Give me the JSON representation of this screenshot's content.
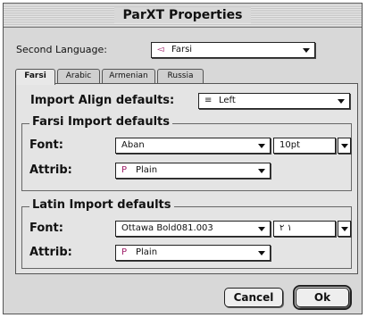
{
  "window": {
    "title": "ParXT Properties"
  },
  "second_language": {
    "label": "Second Language:",
    "value": "Farsi",
    "icon": "language-icon"
  },
  "tabs": [
    {
      "label": "Farsi",
      "active": true
    },
    {
      "label": "Arabic",
      "active": false
    },
    {
      "label": "Armenian",
      "active": false
    },
    {
      "label": "Russia",
      "active": false
    }
  ],
  "import_align": {
    "label": "Import Align defaults:",
    "value": "Left",
    "icon": "align-left-icon"
  },
  "farsi_group": {
    "title": "Farsi Import defaults",
    "font_label": "Font:",
    "font_value": "Aban",
    "size_value": "10pt",
    "attrib_label": "Attrib:",
    "attrib_value": "Plain"
  },
  "latin_group": {
    "title": "Latin Import defaults",
    "font_label": "Font:",
    "font_value": "Ottawa  Bold081.003",
    "size_value": "١ ٢",
    "attrib_label": "Attrib:",
    "attrib_value": "Plain"
  },
  "buttons": {
    "cancel": "Cancel",
    "ok": "Ok"
  }
}
